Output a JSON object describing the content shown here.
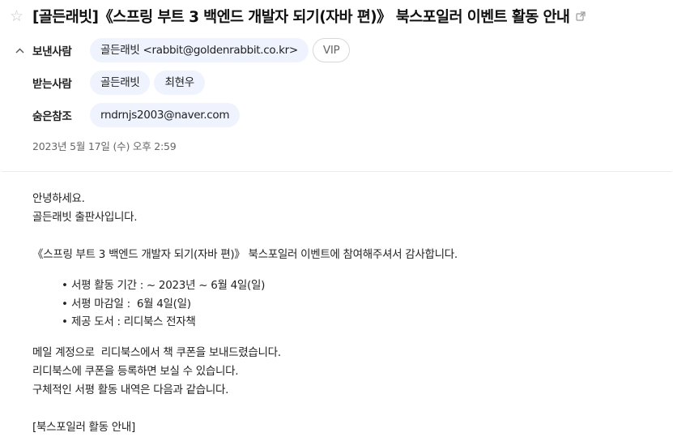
{
  "email": {
    "subject": "[골든래빗]《스프링 부트 3 백엔드 개발자 되기(자바 편)》 북스포일러 이벤트 활동 안내",
    "sender_label": "보낸사람",
    "sender": "골든래빗 <rabbit@goldenrabbit.co.kr>",
    "vip_label": "VIP",
    "recipient_label": "받는사람",
    "recipients": [
      "골든래빗",
      "최현우"
    ],
    "bcc_label": "숨은참조",
    "bcc": "rndrnjs2003@naver.com",
    "date": "2023년 5월 17일 (수) 오후 2:59"
  },
  "body": {
    "greeting1": "안녕하세요.",
    "greeting2": "골든래빗 출판사입니다.",
    "thanks": "《스프링 부트 3 백엔드 개발자 되기(자바 편)》 북스포일러 이벤트에 참여해주셔서 감사합니다.",
    "bullets": [
      "서평 활동 기간 : ~ 2023년 ~ 6월 4일(일)",
      "서평 마감일 :  6월 4일(일)",
      "제공 도서 : 리디북스 전자책"
    ],
    "para1": "메일 계정으로  리디북스에서 책 쿠폰을 보내드렸습니다.",
    "para2": "리디북스에 쿠폰을 등록하면 보실 수 있습니다.",
    "para3": "구체적인 서평 활동 내역은 다음과 같습니다.",
    "section_title": "[북스포일러 활동 안내]"
  },
  "icons": {
    "star": "star-outline-icon",
    "external": "external-link-icon",
    "collapse": "chevron-up-icon"
  },
  "colors": {
    "chip_bg": "#eef3fd",
    "star": "#c8c8c8",
    "divider": "#ececec"
  }
}
